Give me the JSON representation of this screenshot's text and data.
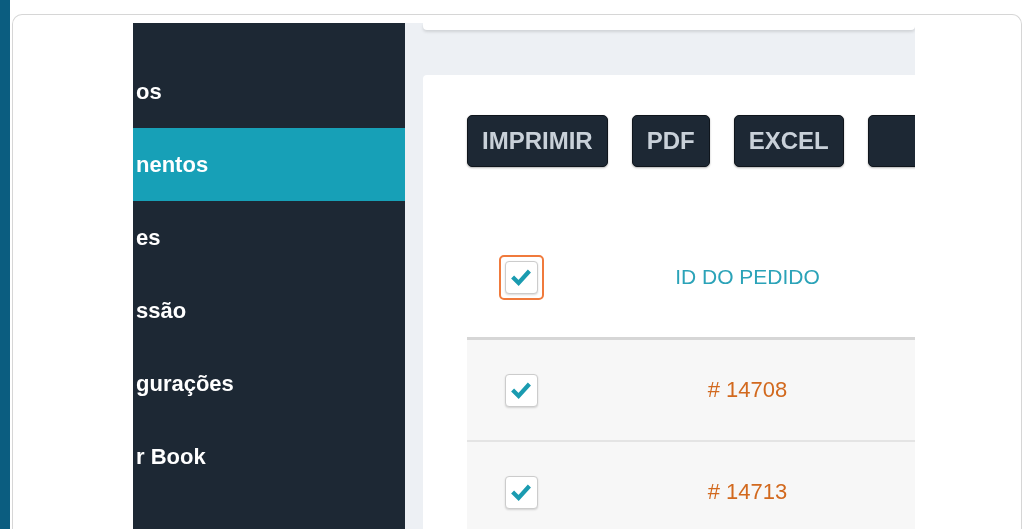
{
  "sidebar": {
    "items": [
      {
        "label": "os",
        "selected": false
      },
      {
        "label": "nentos",
        "selected": true
      },
      {
        "label": "es",
        "selected": false
      },
      {
        "label": "ssão",
        "selected": false
      },
      {
        "label": "gurações",
        "selected": false
      },
      {
        "label": "r Book",
        "selected": false
      }
    ]
  },
  "toolbar": {
    "buttons": [
      "IMPRIMIR",
      "PDF",
      "EXCEL"
    ]
  },
  "table": {
    "header": {
      "checked": true,
      "focused": true,
      "column": "ID DO PEDIDO"
    },
    "rows": [
      {
        "checked": true,
        "id": "# 14708"
      },
      {
        "checked": true,
        "id": "# 14713"
      }
    ]
  }
}
